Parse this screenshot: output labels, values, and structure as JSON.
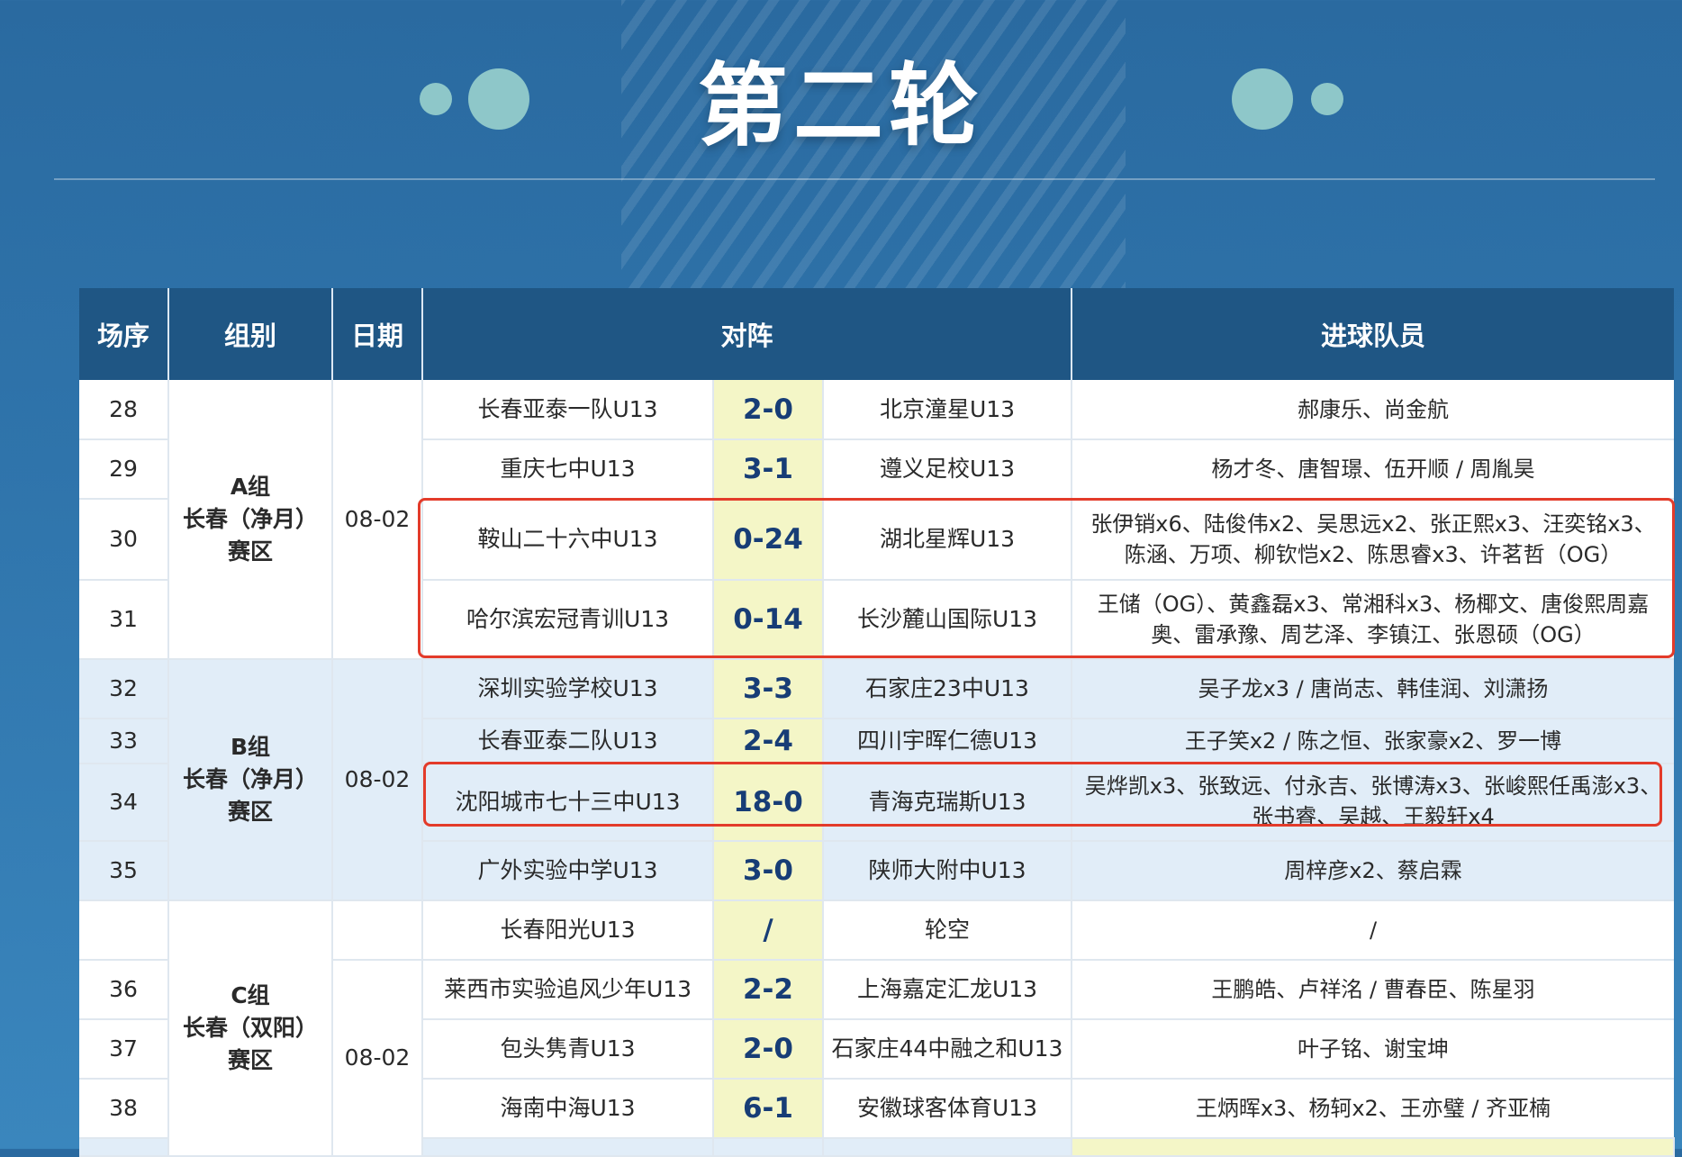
{
  "page": {
    "title": "第二轮",
    "colors": {
      "header_bg": "#1f5684",
      "score_bg": "#f4f6c7",
      "alt_row": "#e1edf8",
      "highlight": "#e33b2a"
    }
  },
  "table": {
    "headers": [
      "场序",
      "组别",
      "日期",
      "对阵",
      "进球队员"
    ],
    "groups": [
      {
        "name": "A组",
        "region": "长春（净月）",
        "suffix": "赛区",
        "date": "08-02"
      },
      {
        "name": "B组",
        "region": "长春（净月）",
        "suffix": "赛区",
        "date": "08-02"
      },
      {
        "name": "C组",
        "region": "长春（双阳）",
        "suffix": "赛区",
        "date": "08-02"
      }
    ],
    "rows": [
      {
        "no": "28",
        "home": "长春亚泰一队U13",
        "score": "2-0",
        "away": "北京潼星U13",
        "scorers": "郝康乐、尚金航"
      },
      {
        "no": "29",
        "home": "重庆七中U13",
        "score": "3-1",
        "away": "遵义足校U13",
        "scorers": "杨才冬、唐智璟、伍开顺 / 周胤昊"
      },
      {
        "no": "30",
        "home": "鞍山二十六中U13",
        "score": "0-24",
        "away": "湖北星辉U13",
        "scorers": "张伊销x6、陆俊伟x2、吴思远x2、张正熙x3、汪奕铭x3、陈涵、万项、柳钦恺x2、陈思睿x3、许茗哲（OG）"
      },
      {
        "no": "31",
        "home": "哈尔滨宏冠青训U13",
        "score": "0-14",
        "away": "长沙麓山国际U13",
        "scorers": "王储（OG）、黄鑫磊x3、常湘科x3、杨椰文、唐俊熙周嘉奥、雷承豫、周艺泽、李镇江、张恩硕（OG）"
      },
      {
        "no": "32",
        "home": "深圳实验学校U13",
        "score": "3-3",
        "away": "石家庄23中U13",
        "scorers": "吴子龙x3 / 唐尚志、韩佳润、刘潇扬"
      },
      {
        "no": "33",
        "home": "长春亚泰二队U13",
        "score": "2-4",
        "away": "四川宇晖仁德U13",
        "scorers": "王子笑x2 / 陈之恒、张家豪x2、罗一博"
      },
      {
        "no": "34",
        "home": "沈阳城市七十三中U13",
        "score": "18-0",
        "away": "青海克瑞斯U13",
        "scorers": "吴烨凯x3、张致远、付永吉、张博涛x3、张峻熙任禹澎x3、张书睿、吴越、王毅轩x4"
      },
      {
        "no": "35",
        "home": "广外实验中学U13",
        "score": "3-0",
        "away": "陕师大附中U13",
        "scorers": "周梓彦x2、蔡启霖"
      },
      {
        "no": "",
        "home": "长春阳光U13",
        "score": "/",
        "away": "轮空",
        "scorers": "/"
      },
      {
        "no": "36",
        "home": "莱西市实验追风少年U13",
        "score": "2-2",
        "away": "上海嘉定汇龙U13",
        "scorers": "王鹏皓、卢祥洺 / 曹春臣、陈星羽"
      },
      {
        "no": "37",
        "home": "包头隽青U13",
        "score": "2-0",
        "away": "石家庄44中融之和U13",
        "scorers": "叶子铭、谢宝坤"
      },
      {
        "no": "38",
        "home": "海南中海U13",
        "score": "6-1",
        "away": "安徽球客体育U13",
        "scorers": "王炳晖x3、杨轲x2、王亦璧 / 齐亚楠"
      }
    ]
  }
}
